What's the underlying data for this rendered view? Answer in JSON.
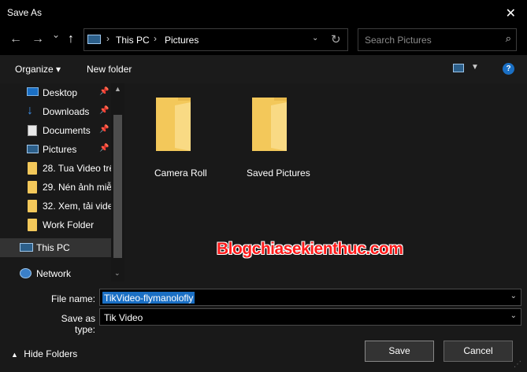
{
  "window": {
    "title": "Save As",
    "close_glyph": "✕"
  },
  "nav_buttons": {
    "back": "←",
    "forward": "→",
    "history": "⌄",
    "up": "↑"
  },
  "address": {
    "crumbs": [
      "This PC",
      "Pictures"
    ],
    "separator": "›"
  },
  "search": {
    "placeholder": "Search Pictures",
    "value": ""
  },
  "toolbar": {
    "organize": "Organize ▾",
    "new_folder": "New folder",
    "help": "?"
  },
  "sidebar": {
    "items": [
      {
        "label": "Desktop",
        "icon": "desktop-icon",
        "pinned": true
      },
      {
        "label": "Downloads",
        "icon": "download-icon",
        "pinned": true
      },
      {
        "label": "Documents",
        "icon": "document-icon",
        "pinned": true
      },
      {
        "label": "Pictures",
        "icon": "pictures-icon",
        "pinned": true
      },
      {
        "label": "28. Tua Video trê",
        "icon": "folder-icon",
        "pinned": false
      },
      {
        "label": "29. Nén ảnh miễ",
        "icon": "folder-icon",
        "pinned": false
      },
      {
        "label": "32. Xem, tải vide",
        "icon": "folder-icon",
        "pinned": false
      },
      {
        "label": "Work Folder",
        "icon": "folder-icon",
        "pinned": false
      },
      {
        "label": "This PC",
        "icon": "computer-icon",
        "pinned": false,
        "selected": true
      },
      {
        "label": "Network",
        "icon": "network-icon",
        "pinned": false
      }
    ]
  },
  "folders": [
    {
      "name": "Camera Roll"
    },
    {
      "name": "Saved Pictures"
    }
  ],
  "watermark": "Blogchiasekienthuc.com",
  "form": {
    "file_name_label": "File name:",
    "file_name_value": "TikVideo-flymanolofly",
    "save_type_label": "Save as type:",
    "save_type_value": "Tik Video"
  },
  "footer": {
    "hide_folders": "Hide Folders",
    "save": "Save",
    "cancel": "Cancel"
  },
  "colors": {
    "accent": "#1a6fc4",
    "folder": "#f3c85a",
    "watermark": "#ff1a1a"
  }
}
